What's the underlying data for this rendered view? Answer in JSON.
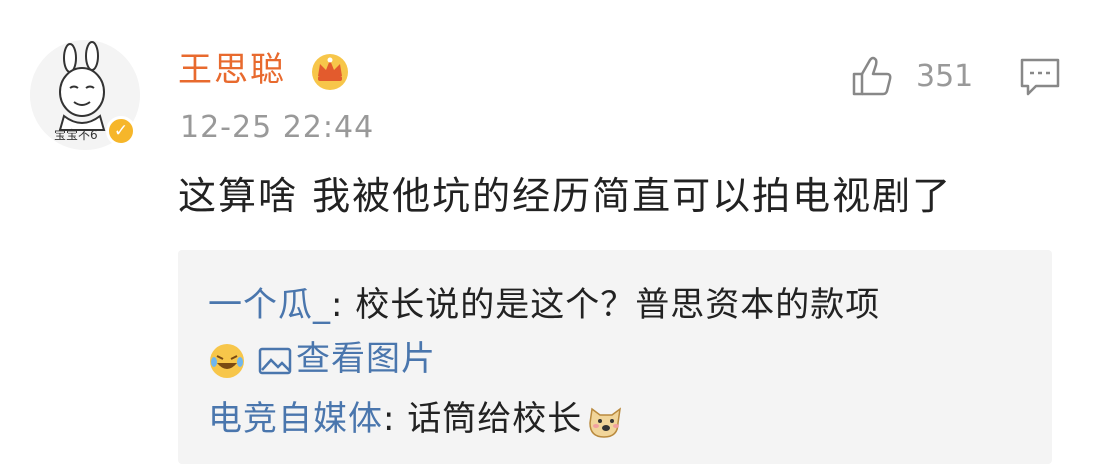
{
  "comment": {
    "username": "王思聪",
    "timestamp": "12-25 22:44",
    "like_count": "351",
    "text": "这算啥 我被他坑的经历简直可以拍电视剧了",
    "avatar_label": "宝宝不6"
  },
  "replies": [
    {
      "author": "一个瓜_",
      "separator": ": ",
      "text": "校长说的是这个？普思资本的款项",
      "image_link": "查看图片"
    },
    {
      "author": "电竞自媒体",
      "separator": ": ",
      "text": "话筒给校长"
    }
  ],
  "colors": {
    "username": "#e86a2e",
    "reply_author": "#4a76ad",
    "meta": "#999999",
    "reply_bg": "#f4f4f4",
    "verified_badge": "#f6b62a"
  },
  "icons": {
    "crown": "crown-icon",
    "verified": "verified-badge-icon",
    "like": "thumbs-up-icon",
    "comment": "comment-icon",
    "laugh": "laugh-cry-emoji-icon",
    "picture": "picture-icon",
    "dog": "doge-emoji-icon"
  }
}
